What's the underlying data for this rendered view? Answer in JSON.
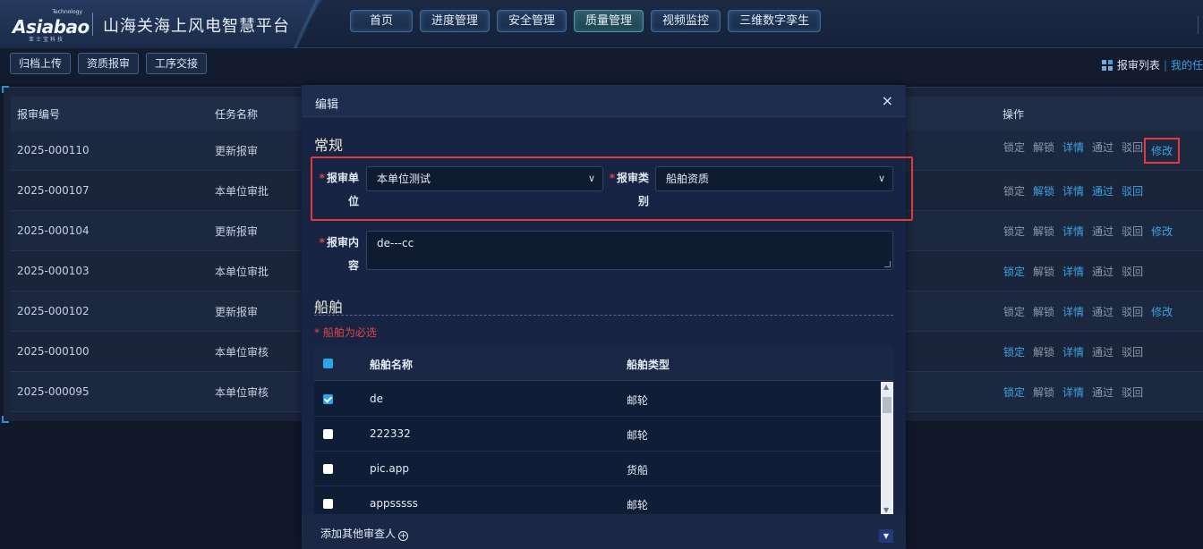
{
  "brand": {
    "logo_text": "Asiabao",
    "logo_tag": "Technology",
    "logo_sub": "亚士宝科技",
    "platform_title": "山海关海上风电智慧平台"
  },
  "nav": [
    {
      "label": "首页"
    },
    {
      "label": "进度管理"
    },
    {
      "label": "安全管理"
    },
    {
      "label": "质量管理",
      "active": true
    },
    {
      "label": "视频监控"
    },
    {
      "label": "三维数字孪生"
    }
  ],
  "toolbar": {
    "buttons": [
      "归档上传",
      "资质报审",
      "工序交接"
    ],
    "right_label": "报审列表",
    "right_link": "我的任"
  },
  "list": {
    "headers": {
      "no": "报审编号",
      "name": "任务名称",
      "ops": "操作"
    },
    "rows": [
      {
        "no": "2025-000110",
        "name": "更新报审",
        "ops": [
          [
            "锁定",
            false
          ],
          [
            "解锁",
            false
          ],
          [
            "详情",
            true
          ],
          [
            "通过",
            false
          ],
          [
            "驳回",
            false
          ],
          [
            "修改",
            true
          ]
        ]
      },
      {
        "no": "2025-000107",
        "name": "本单位审批",
        "ops": [
          [
            "锁定",
            false
          ],
          [
            "解锁",
            true
          ],
          [
            "详情",
            true
          ],
          [
            "通过",
            true
          ],
          [
            "驳回",
            true
          ]
        ]
      },
      {
        "no": "2025-000104",
        "name": "更新报审",
        "ops": [
          [
            "锁定",
            false
          ],
          [
            "解锁",
            false
          ],
          [
            "详情",
            true
          ],
          [
            "通过",
            false
          ],
          [
            "驳回",
            false
          ],
          [
            "修改",
            true
          ]
        ]
      },
      {
        "no": "2025-000103",
        "name": "本单位审批",
        "ops": [
          [
            "锁定",
            true
          ],
          [
            "解锁",
            false
          ],
          [
            "详情",
            true
          ],
          [
            "通过",
            false
          ],
          [
            "驳回",
            false
          ]
        ]
      },
      {
        "no": "2025-000102",
        "name": "更新报审",
        "ops": [
          [
            "锁定",
            false
          ],
          [
            "解锁",
            false
          ],
          [
            "详情",
            true
          ],
          [
            "通过",
            false
          ],
          [
            "驳回",
            false
          ],
          [
            "修改",
            true
          ]
        ]
      },
      {
        "no": "2025-000100",
        "name": "本单位审核",
        "ops": [
          [
            "锁定",
            true
          ],
          [
            "解锁",
            false
          ],
          [
            "详情",
            true
          ],
          [
            "通过",
            false
          ],
          [
            "驳回",
            false
          ]
        ]
      },
      {
        "no": "2025-000095",
        "name": "本单位审核",
        "ops": [
          [
            "锁定",
            true
          ],
          [
            "解锁",
            false
          ],
          [
            "详情",
            true
          ],
          [
            "通过",
            false
          ],
          [
            "驳回",
            false
          ]
        ]
      }
    ]
  },
  "modal": {
    "title": "编辑",
    "close": "×",
    "section_general": "常规",
    "unit_label_a": "报审单",
    "unit_label_b": "位",
    "unit_value": "本单位测试",
    "type_label_a": "报审类",
    "type_label_b": "别",
    "type_value": "船舶资质",
    "content_label_a": "报审内",
    "content_label_b": "容",
    "content_value": "de---cc",
    "section_ship": "船舶",
    "ship_required": "* 船舶为必选",
    "ship_headers": {
      "name": "船舶名称",
      "type": "船舶类型"
    },
    "ships": [
      {
        "name": "de",
        "type": "邮轮",
        "checked": true
      },
      {
        "name": "222332",
        "type": "邮轮",
        "checked": false
      },
      {
        "name": "pic.app",
        "type": "货船",
        "checked": false
      },
      {
        "name": "appsssss",
        "type": "邮轮",
        "checked": false
      }
    ],
    "add_reviewer": "添加其他审查人"
  },
  "colors": {
    "accent_link": "#3ea3e2",
    "highlight_red": "#e03a3a",
    "required_red": "#e04646"
  }
}
